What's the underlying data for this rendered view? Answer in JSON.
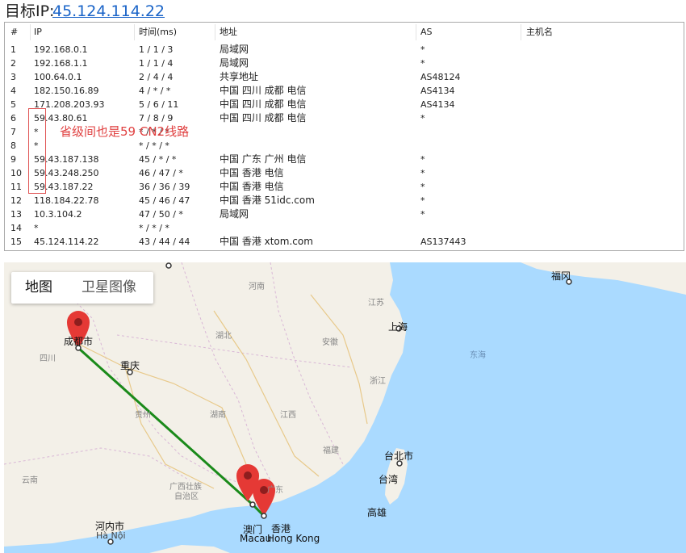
{
  "header": {
    "label": "目标IP:",
    "ip": "45.124.114.22"
  },
  "table": {
    "columns": [
      "#",
      "IP",
      "时间(ms)",
      "地址",
      "AS",
      "主机名"
    ],
    "rows": [
      {
        "n": "1",
        "ip": "192.168.0.1",
        "ms": "1 / 1 / 3",
        "addr": "局域网",
        "as": "*"
      },
      {
        "n": "2",
        "ip": "192.168.1.1",
        "ms": "1 / 1 / 4",
        "addr": "局域网",
        "as": "*"
      },
      {
        "n": "3",
        "ip": "100.64.0.1",
        "ms": "2 / 4 / 4",
        "addr": "共享地址",
        "as": "AS48124"
      },
      {
        "n": "4",
        "ip": "182.150.16.89",
        "ms": "4 / * / *",
        "addr": "中国 四川 成都 电信",
        "as": "AS4134"
      },
      {
        "n": "5",
        "ip": "171.208.203.93",
        "ms": "5 / 6 / 11",
        "addr": "中国 四川 成都 电信",
        "as": "AS4134"
      },
      {
        "n": "6",
        "ip": "59.43.80.61",
        "ms": "7 / 8 / 9",
        "addr": "中国 四川 成都 电信",
        "as": "*"
      },
      {
        "n": "7",
        "ip": "*",
        "ms": "* / * / *",
        "addr": "",
        "as": ""
      },
      {
        "n": "8",
        "ip": "*",
        "ms": "* / * / *",
        "addr": "",
        "as": ""
      },
      {
        "n": "9",
        "ip": "59.43.187.138",
        "ms": "45 / * / *",
        "addr": "中国 广东 广州 电信",
        "as": "*"
      },
      {
        "n": "10",
        "ip": "59.43.248.250",
        "ms": "46 / 47 / *",
        "addr": "中国 香港 电信",
        "as": "*"
      },
      {
        "n": "11",
        "ip": "59.43.187.22",
        "ms": "36 / 36 / 39",
        "addr": "中国 香港 电信",
        "as": "*"
      },
      {
        "n": "12",
        "ip": "118.184.22.78",
        "ms": "45 / 46 / 47",
        "addr": "中国 香港 51idc.com",
        "as": "*"
      },
      {
        "n": "13",
        "ip": "10.3.104.2",
        "ms": "47 / 50 / *",
        "addr": "局域网",
        "as": "*"
      },
      {
        "n": "14",
        "ip": "*",
        "ms": "* / * / *",
        "addr": "",
        "as": ""
      },
      {
        "n": "15",
        "ip": "45.124.114.22",
        "ms": "43 / 44 / 44",
        "addr": "中国 香港 xtom.com",
        "as": "AS137443"
      }
    ]
  },
  "annotation": {
    "text": "省级间也是59 CN2线路"
  },
  "map": {
    "tabs": {
      "map": "地图",
      "satellite": "卫星图像"
    },
    "labels": {
      "chengdu": "成都市",
      "sichuan": "四川",
      "chongqing": "重庆",
      "guizhou": "贵州",
      "hunan": "湖南",
      "hubei": "湖北",
      "henan": "河南",
      "anhui": "安徽",
      "jiangsu": "江苏",
      "shanghai": "上海",
      "zhejiang": "浙江",
      "jiangxi": "江西",
      "fujian": "福建",
      "taibei": "台北市",
      "taiwan": "台湾",
      "gaoxiong": "高雄",
      "guangxi1": "广西壮族",
      "guangxi2": "自治区",
      "guangdong": "广东",
      "yunnan": "云南",
      "hanoi1": "河内市",
      "hanoi2": "Hà Nội",
      "aomen": "澳门",
      "macau": "Macau",
      "xianggang": "香港",
      "hongkong": "Hong Kong",
      "donghai": "东海",
      "fukuoka": "福冈"
    },
    "colors": {
      "route": "#1a8a1a",
      "pin": "#e53935",
      "land": "#f3f0e8",
      "water": "#aadaff"
    }
  }
}
